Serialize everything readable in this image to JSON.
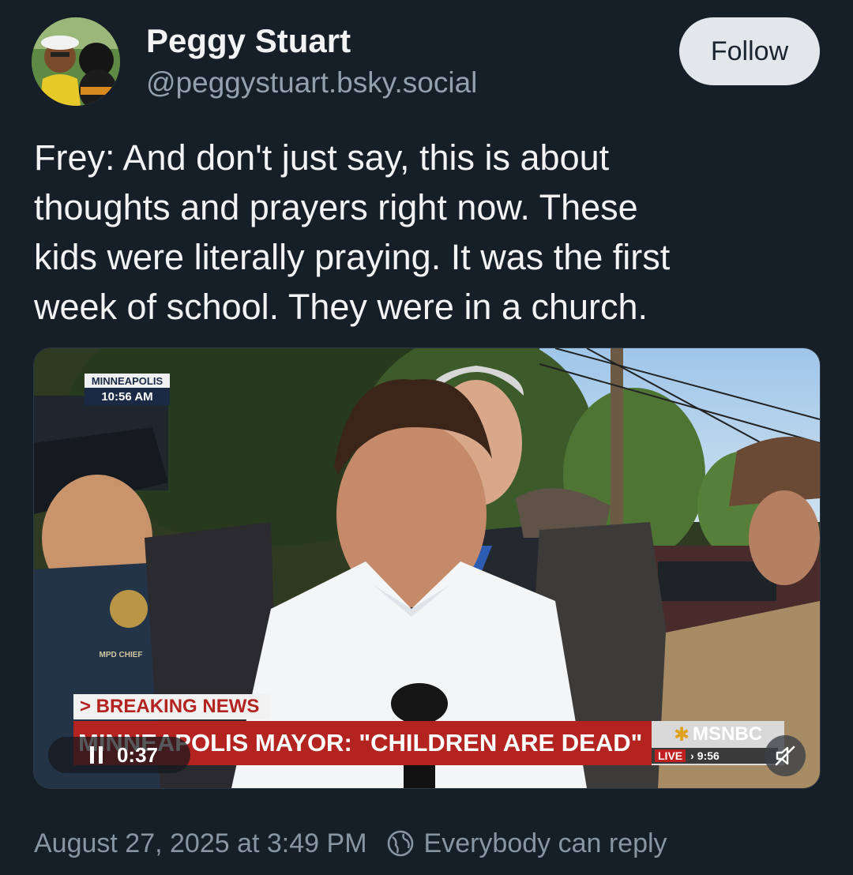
{
  "author": {
    "display_name": "Peggy Stuart",
    "handle": "@peggystuart.bsky.social",
    "follow_label": "Follow"
  },
  "post": {
    "text": "Frey: And don't just say, this is about\nthoughts and prayers right now. These\nkids were literally praying. It was the first\nweek of school. They were in a church.",
    "timestamp": "August 27, 2025 at 3:49 PM",
    "reply_setting": "Everybody can reply"
  },
  "video": {
    "location_bug_city": "MINNEAPOLIS",
    "location_bug_time": "10:56 AM",
    "badge_text": "MPD CHIEF",
    "breaking_label": "> BREAKING NEWS",
    "headline": "MINNEAPOLIS MAYOR: \"CHILDREN ARE DEAD\"",
    "network": "MSNBC",
    "live_label": "LIVE",
    "live_time": "9:56",
    "elapsed": "0:37",
    "pause_icon": "pause-icon",
    "mute_icon": "speaker-muted-icon"
  },
  "colors": {
    "background": "#161e27",
    "follow_button": "#e2e7ec",
    "secondary_text": "#8895a3",
    "news_red": "#b3231f"
  }
}
